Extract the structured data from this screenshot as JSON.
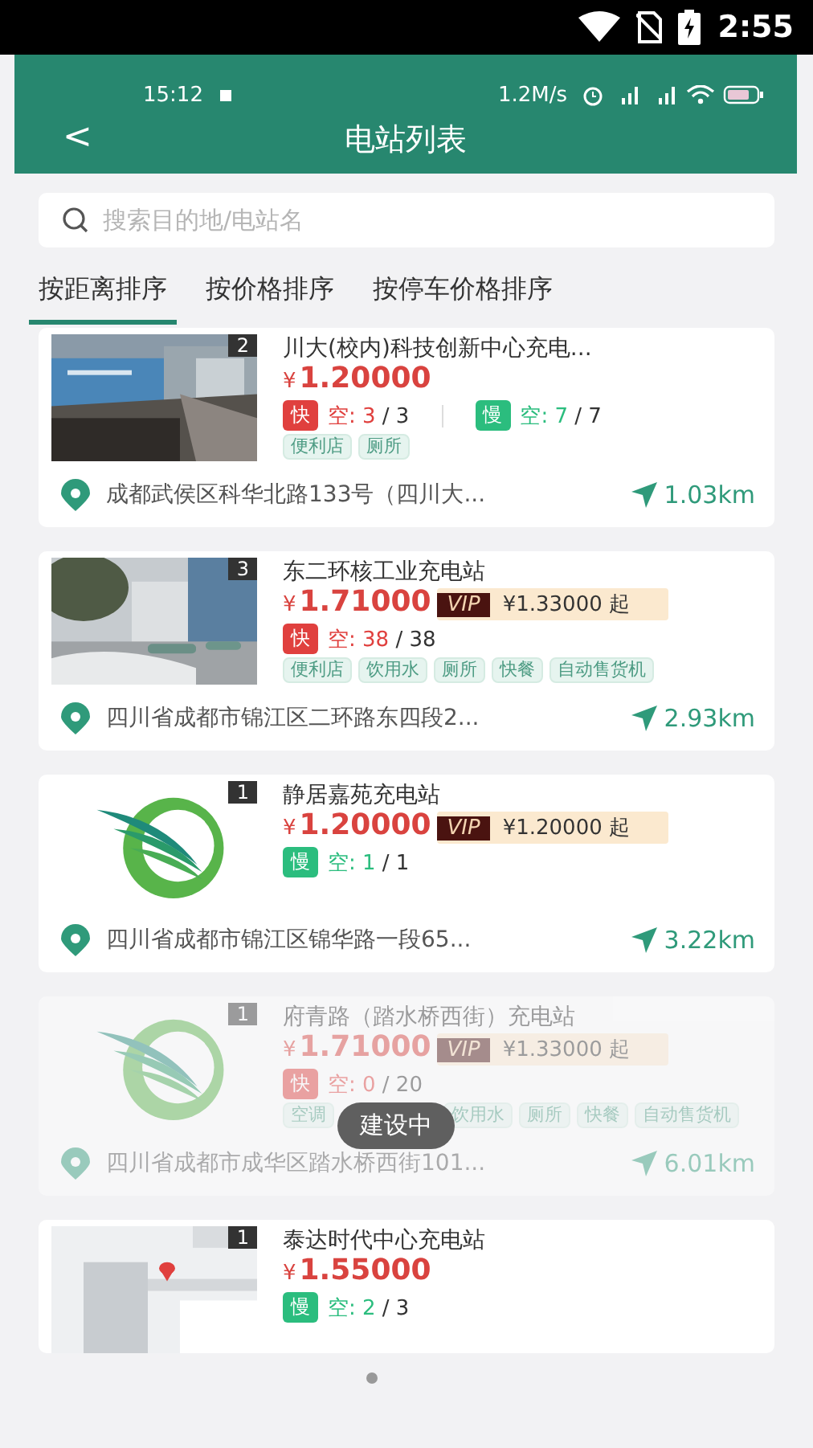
{
  "status_bar": {
    "time": "2:55"
  },
  "app_status_bar": {
    "time": "15:12",
    "speed": "1.2M/s"
  },
  "header": {
    "back": "<",
    "title": "电站列表"
  },
  "search": {
    "placeholder": "搜索目的地/电站名"
  },
  "tabs": [
    {
      "label": "按距离排序",
      "selected": true
    },
    {
      "label": "按价格排序",
      "selected": false
    },
    {
      "label": "按停车价格排序",
      "selected": false
    }
  ],
  "stations": [
    {
      "rank": "2",
      "name": "川大(校内)科技创新中心充电...",
      "currency": "¥",
      "price": "1.20000",
      "disabled": false,
      "chargers": [
        {
          "kind": "fast",
          "badge": "快",
          "label": "空:",
          "free": "3",
          "total": "/ 3"
        },
        {
          "kind": "slow",
          "badge": "慢",
          "label": "空:",
          "free": "7",
          "total": "/ 7"
        }
      ],
      "tags": [
        "便利店",
        "厕所"
      ],
      "address": "成都武侯区科华北路133号（四川大...",
      "distance": "1.03km"
    },
    {
      "kind": "street",
      "rank": "3",
      "name": "东二环核工业充电站",
      "currency": "¥",
      "price": "1.71000",
      "vip": {
        "badge": "VIP",
        "price": "¥1.33000 起"
      },
      "disabled": false,
      "chargers": [
        {
          "kind": "fast",
          "badge": "快",
          "label": "空:",
          "free": "38",
          "total": "/ 38"
        }
      ],
      "tags": [
        "便利店",
        "饮用水",
        "厕所",
        "快餐",
        "自动售货机"
      ],
      "address": "四川省成都市锦江区二环路东四段2...",
      "distance": "2.93km"
    },
    {
      "kind": "logo",
      "rank": "1",
      "name": "静居嘉苑充电站",
      "currency": "¥",
      "price": "1.20000",
      "vip": {
        "badge": "VIP",
        "price": "¥1.20000 起"
      },
      "disabled": false,
      "chargers": [
        {
          "kind": "slow",
          "badge": "慢",
          "label": "空:",
          "free": "1",
          "total": "/ 1"
        }
      ],
      "address": "四川省成都市锦江区锦华路一段65...",
      "distance": "3.22km"
    },
    {
      "kind": "logo",
      "rank": "1",
      "name": "府青路（踏水桥西街）充电站",
      "currency": "¥",
      "price": "1.71000",
      "vip": {
        "badge": "VIP",
        "price": "¥1.33000 起"
      },
      "disabled": true,
      "chargers": [
        {
          "kind": "fast",
          "badge": "快",
          "label": "空:",
          "free": "0",
          "total": "/ 20"
        }
      ],
      "tags": [
        "空调",
        "饮用水",
        "厕所",
        "快餐",
        "自动售货机"
      ],
      "address": "四川省成都市成华区踏水桥西街101...",
      "distance": "6.01km"
    },
    {
      "kind": "map",
      "rank": "1",
      "name": "泰达时代中心充电站",
      "currency": "¥",
      "price": "1.55000",
      "disabled": false,
      "chargers": [
        {
          "kind": "slow",
          "badge": "慢",
          "label": "空:",
          "free": "2",
          "total": "/ 3"
        }
      ]
    }
  ],
  "toast": "建设中"
}
